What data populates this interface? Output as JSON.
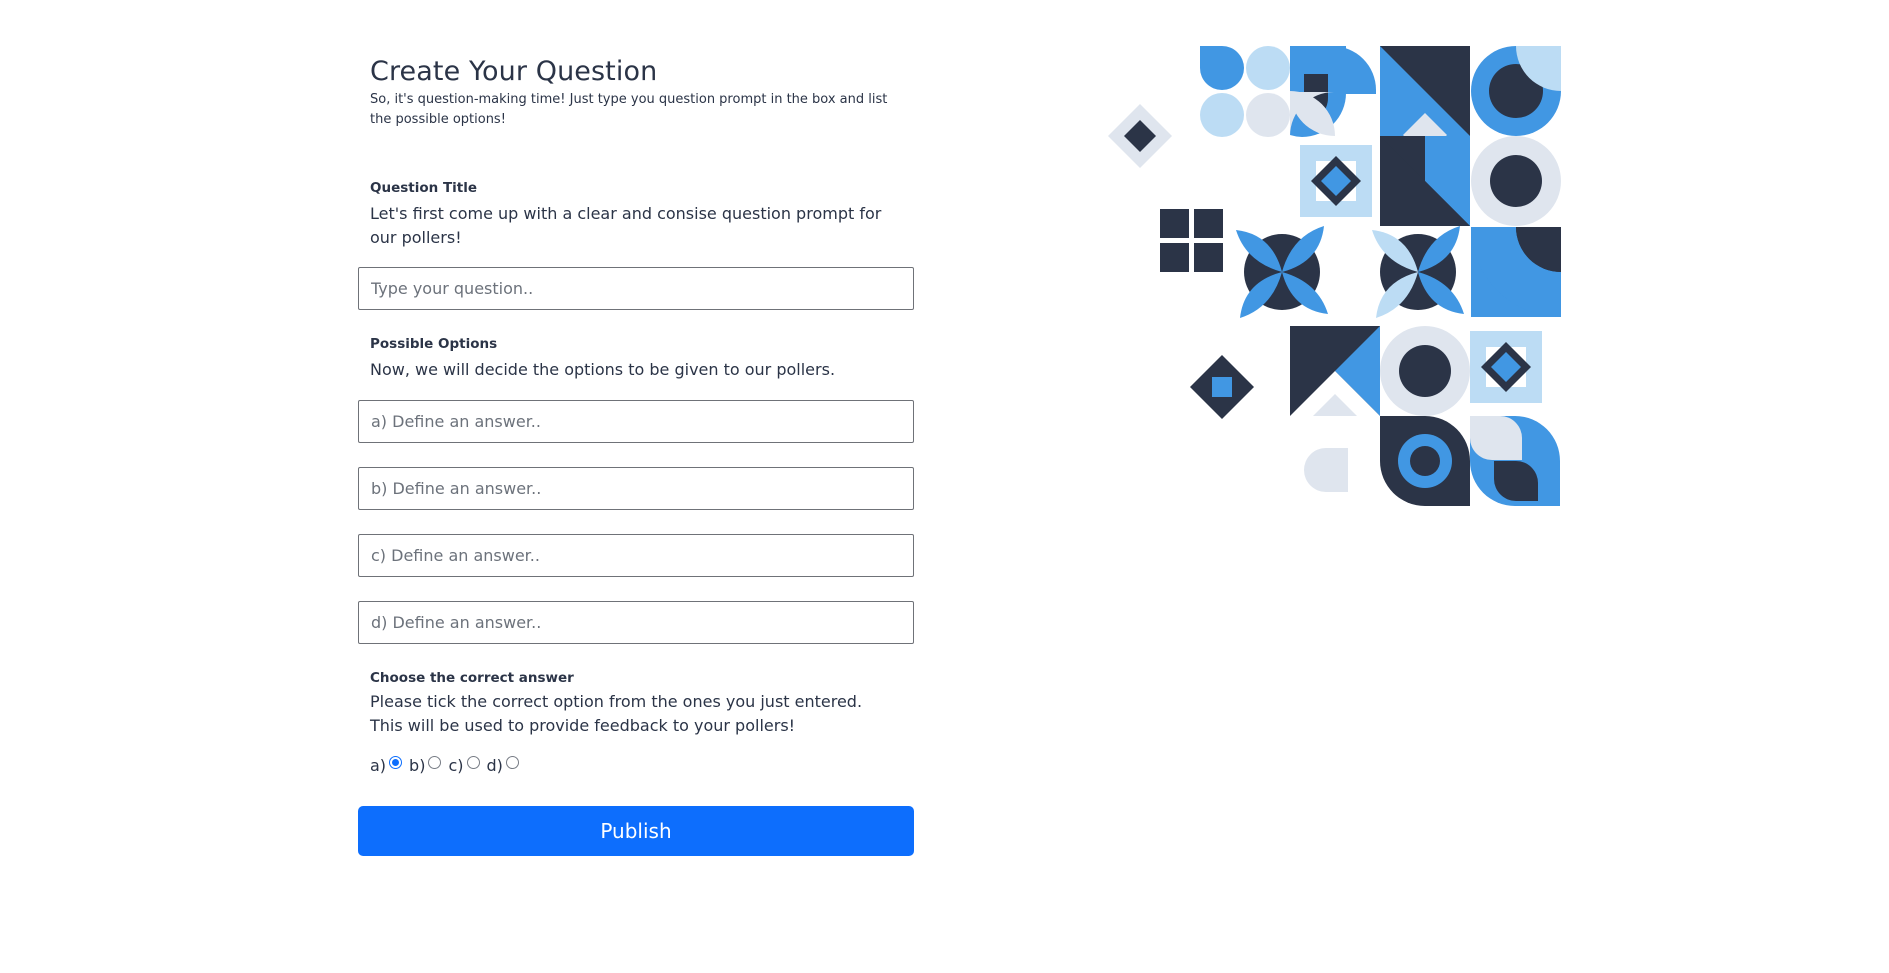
{
  "header": {
    "title": "Create Your Question",
    "subtitle": "So, it's question-making time! Just type you question prompt in the box and list the possible options!"
  },
  "question": {
    "label": "Question Title",
    "description": "Let's first come up with a clear and consise question prompt for our pollers!",
    "placeholder": "Type your question.."
  },
  "options": {
    "label": "Possible Options",
    "description": "Now, we will decide the options to be given to our pollers.",
    "placeholders": [
      "a) Define an answer..",
      "b) Define an answer..",
      "c) Define an answer..",
      "d) Define an answer.."
    ]
  },
  "correct": {
    "label": "Choose the correct answer",
    "description_line1": "Please tick the correct option from the ones you just entered.",
    "description_line2": "This will be used to provide feedback to your pollers!",
    "choices": [
      "a)",
      "b)",
      "c)",
      "d)"
    ],
    "selected": "a)"
  },
  "publish_label": "Publish",
  "colors": {
    "primary": "#0d6efd",
    "navy": "#2b3447",
    "blue": "#4197e3",
    "light_blue": "#bcdcf4",
    "light_gray": "#dfe5ee"
  },
  "illustration": "geometric-pattern"
}
